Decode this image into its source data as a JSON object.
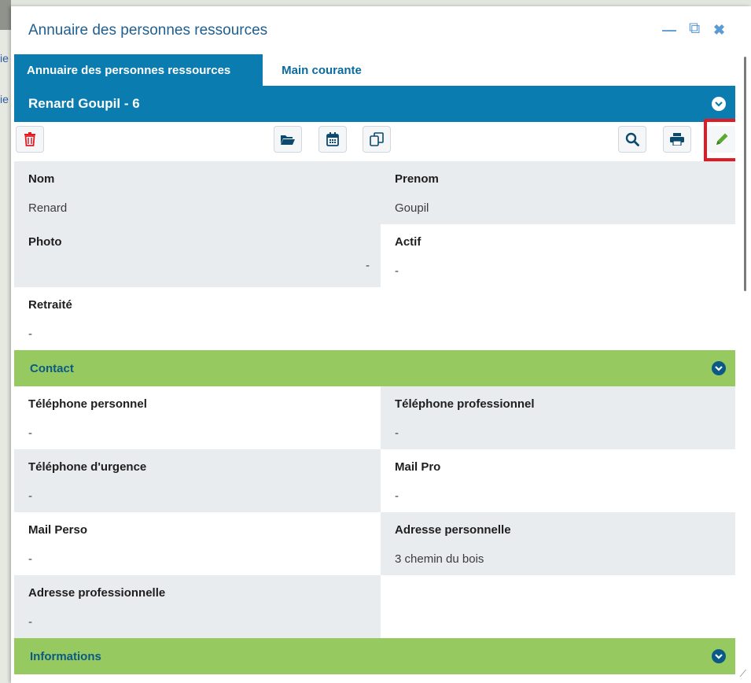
{
  "window": {
    "title": "Annuaire des personnes ressources",
    "controls": {
      "minimize": "—",
      "restore": "⧉",
      "close": "✖"
    }
  },
  "tabs": [
    {
      "label": "Annuaire des personnes ressources",
      "active": true
    },
    {
      "label": "Main courante",
      "active": false
    }
  ],
  "record": {
    "title": "Renard Goupil - 6"
  },
  "toolbar": {
    "icons": [
      "trash-icon",
      "folder-open-icon",
      "calendar-icon",
      "copy-icon",
      "search-icon",
      "print-icon",
      "pencil-icon"
    ]
  },
  "fields_main": [
    {
      "label": "Nom",
      "value": "Renard"
    },
    {
      "label": "Prenom",
      "value": "Goupil"
    },
    {
      "label": "Photo",
      "value": "-"
    },
    {
      "label": "Actif",
      "value": "-"
    },
    {
      "label": "Retraité",
      "value": "-"
    }
  ],
  "sections": {
    "contact": "Contact",
    "informations": "Informations"
  },
  "fields_contact": [
    {
      "label": "Téléphone personnel",
      "value": "-"
    },
    {
      "label": "Téléphone professionnel",
      "value": "-"
    },
    {
      "label": "Téléphone d'urgence",
      "value": "-"
    },
    {
      "label": "Mail Pro",
      "value": "-"
    },
    {
      "label": "Mail Perso",
      "value": "-"
    },
    {
      "label": "Adresse personnelle",
      "value": "3 chemin du bois"
    },
    {
      "label": "Adresse professionnelle",
      "value": "-"
    }
  ],
  "background": {
    "frag1": "ie",
    "frag2": "ie"
  },
  "colors": {
    "primary": "#0b7cb0",
    "section": "#96c95f",
    "danger": "#e01b24",
    "edit": "#5aa832"
  }
}
